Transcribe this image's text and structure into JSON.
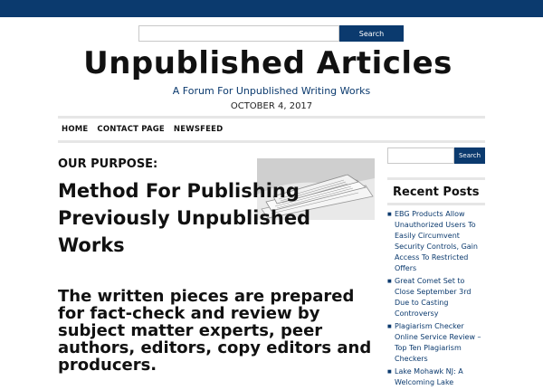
{
  "search": {
    "placeholder": "",
    "button_label": "Search"
  },
  "site": {
    "title": "Unpublished Articles",
    "tagline": "A Forum For Unpublished Writing Works",
    "date": "OCTOBER 4, 2017"
  },
  "nav": {
    "items": [
      "HOME",
      "CONTACT PAGE",
      "NEWSFEED"
    ]
  },
  "main": {
    "purpose_label": "OUR PURPOSE:",
    "heading": "Method For Publishing Previously Unpublished Works",
    "body": "The written pieces are prepared for fact-check and review by subject matter experts, peer authors, editors, copy editors and producers."
  },
  "sidebar": {
    "search": {
      "placeholder": "",
      "button_label": "Search"
    },
    "recent_title": "Recent Posts",
    "recent_posts": [
      "EBG Products Allow Unauthorized Users To Easily Circumvent Security Controls, Gain Access To Restricted Offers",
      "Great Comet Set to Close September 3rd Due to Casting Controversy",
      "Plagiarism Checker Online Service Review – Top Ten Plagiarism Checkers",
      "Lake Mohawk NJ: A Welcoming Lake"
    ]
  },
  "colors": {
    "accent": "#0b3a6e",
    "divider": "#e6e6e6"
  },
  "image": {
    "icon": "newspaper-stack-image"
  }
}
